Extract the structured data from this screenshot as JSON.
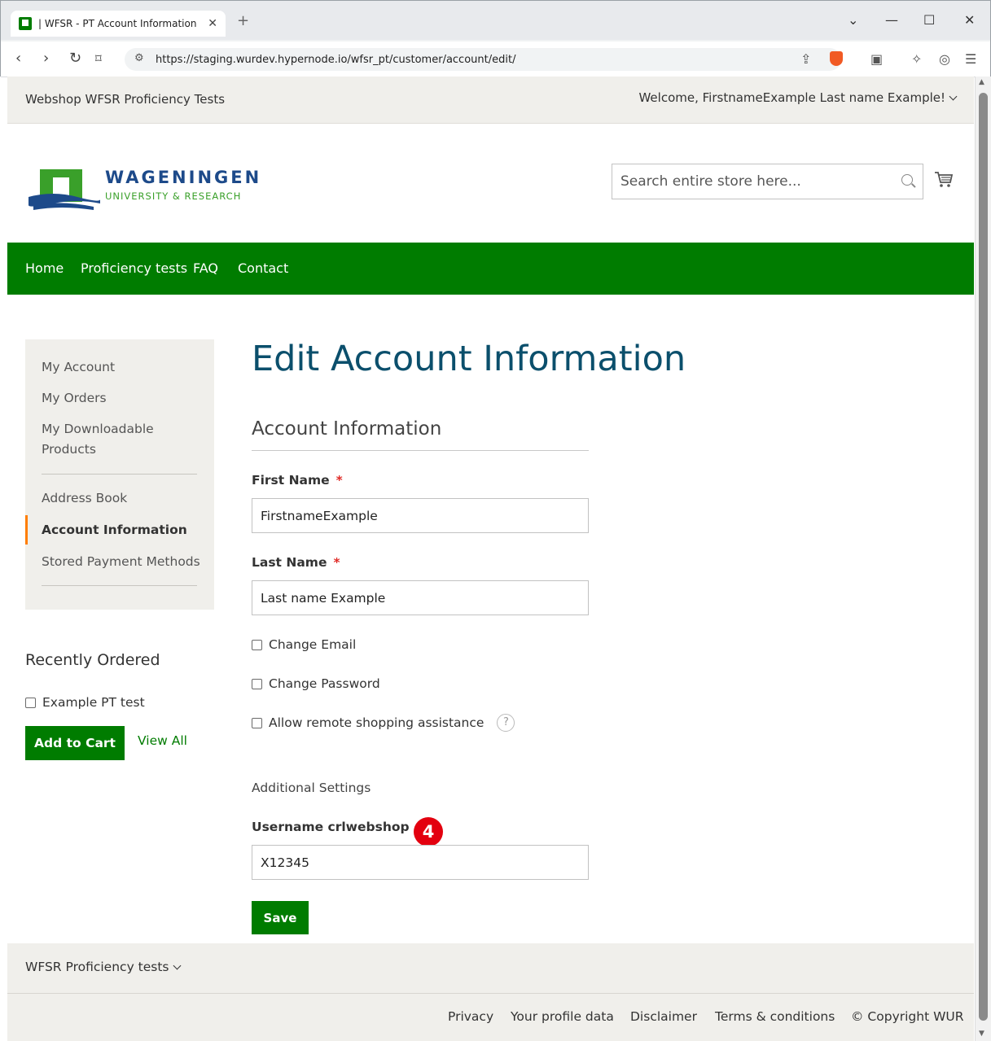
{
  "browser": {
    "tab_title": "| WFSR - PT Account Information",
    "tab_close": "✕",
    "new_tab": "+",
    "url": "https://staging.wurdev.hypernode.io/wfsr_pt/customer/account/edit/"
  },
  "header": {
    "shop_name": "Webshop WFSR Proficiency Tests",
    "welcome": "Welcome, FirstnameExample Last name Example!",
    "logo_word": "WAGENINGEN",
    "logo_sub": "UNIVERSITY & RESEARCH",
    "search_placeholder": "Search entire store here..."
  },
  "nav": {
    "home": "Home",
    "proficiency": "Proficiency tests",
    "faq": "FAQ",
    "contact": "Contact"
  },
  "sidebar": {
    "my_account": "My Account",
    "my_orders": "My Orders",
    "my_downloadable_1": "My Downloadable",
    "my_downloadable_2": "Products",
    "address_book": "Address Book",
    "account_information": "Account Information",
    "stored_payment": "Stored Payment Methods"
  },
  "recent": {
    "title": "Recently Ordered",
    "item": "Example PT test",
    "add_to_cart": "Add to Cart",
    "view_all": "View All"
  },
  "main": {
    "title": "Edit Account Information",
    "section_title": "Account Information",
    "first_name_label": "First Name",
    "first_name_value": "FirstnameExample",
    "last_name_label": "Last Name",
    "last_name_value": "Last name Example",
    "required_mark": "*",
    "change_email": "Change Email",
    "change_password": "Change Password",
    "remote_assistance": "Allow remote shopping assistance",
    "help": "?",
    "additional_settings": "Additional Settings",
    "username_label": "Username crlwebshop",
    "username_value": "X12345",
    "save": "Save",
    "annotation_number": "4"
  },
  "footer": {
    "proficiency": "WFSR Proficiency tests",
    "privacy": "Privacy",
    "profile_data": "Your profile data",
    "disclaimer": "Disclaimer",
    "terms": "Terms & conditions",
    "copyright": "© Copyright WUR"
  },
  "colors": {
    "brand_green": "#007c00",
    "title_blue": "#0b4f6c",
    "active_orange": "#ff7e00",
    "badge_red": "#e3000f"
  }
}
